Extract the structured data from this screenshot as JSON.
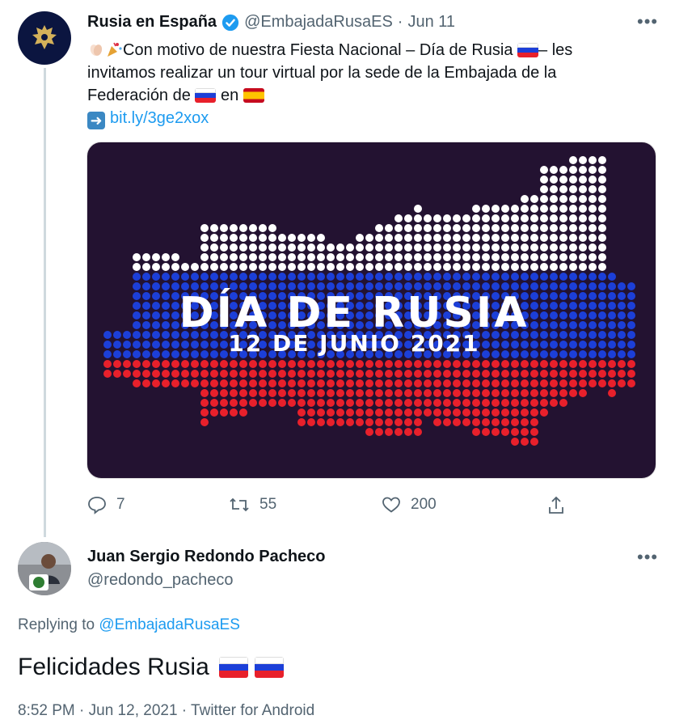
{
  "tweet1": {
    "display_name": "Rusia en España",
    "handle": "@EmbajadaRusaES",
    "date": "Jun 11",
    "text_line1": "Con motivo de nuestra Fiesta Nacional – Día de Rusia",
    "text_line1_tail": "– les",
    "text_line2": "invitamos realizar un tour virtual por la sede de la Embajada de la",
    "text_line3": "Federación de",
    "text_line3_mid": "en",
    "link": "bit.ly/3ge2xox",
    "media": {
      "title": "DÍA DE RUSIA",
      "subtitle": "12 DE JUNIO 2021"
    },
    "actions": {
      "replies": "7",
      "retweets": "55",
      "likes": "200"
    }
  },
  "tweet2": {
    "display_name": "Juan Sergio Redondo Pacheco",
    "handle": "@redondo_pacheco",
    "replying_prefix": "Replying to",
    "replying_handle": "@EmbajadaRusaES",
    "text": "Felicidades Rusia",
    "footer": "8:52 PM · Jun 12, 2021 · Twitter for Android"
  },
  "colors": {
    "link": "#1d9bf0",
    "muted": "#536471",
    "verified": "#1d9bf0",
    "media_bg": "#231231",
    "flag_white": "#ffffff",
    "flag_blue": "#1c3fd8",
    "flag_red": "#e8202b"
  }
}
